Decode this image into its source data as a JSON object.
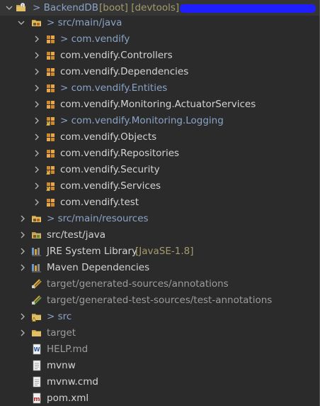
{
  "project": {
    "name": "BackendDB",
    "tags": "[boot] [devtools]"
  },
  "items": [
    {
      "label": "> src/main/java",
      "style": "blue"
    },
    {
      "label": "> com.vendify",
      "style": "blue"
    },
    {
      "label": "com.vendify.Controllers",
      "style": "white"
    },
    {
      "label": "com.vendify.Dependencies",
      "style": "white"
    },
    {
      "label": "> com.vendify.Entities",
      "style": "blue"
    },
    {
      "label": "com.vendify.Monitoring.ActuatorServices",
      "style": "white"
    },
    {
      "label": "> com.vendify.Monitoring.Logging",
      "style": "blue"
    },
    {
      "label": "com.vendify.Objects",
      "style": "white"
    },
    {
      "label": "com.vendify.Repositories",
      "style": "white"
    },
    {
      "label": "com.vendify.Security",
      "style": "white"
    },
    {
      "label": "com.vendify.Services",
      "style": "white"
    },
    {
      "label": "com.vendify.test",
      "style": "white"
    },
    {
      "label": "> src/main/resources",
      "style": "blue"
    },
    {
      "label": "src/test/java",
      "style": "white"
    },
    {
      "label": "JRE System Library",
      "suffix": "[JavaSE-1.8]",
      "style": "white"
    },
    {
      "label": "Maven Dependencies",
      "style": "white"
    },
    {
      "label": "target/generated-sources/annotations",
      "style": "grey"
    },
    {
      "label": "target/generated-test-sources/test-annotations",
      "style": "grey"
    },
    {
      "label": "> src",
      "style": "blue"
    },
    {
      "label": "target",
      "style": "grey"
    },
    {
      "label": "HELP.md",
      "style": "grey"
    },
    {
      "label": "mvnw",
      "style": "white"
    },
    {
      "label": "mvnw.cmd",
      "style": "white"
    },
    {
      "label": "pom.xml",
      "style": "white"
    }
  ],
  "colors": {
    "background": "#2b2b2b",
    "text": "#d4d4d4",
    "modified_blue": "#8aa4c8",
    "decorator_olive": "#a59b6b",
    "derived_grey": "#9c9c9c",
    "package_orange": "#d08a2a",
    "redaction": "#1e1eff"
  }
}
